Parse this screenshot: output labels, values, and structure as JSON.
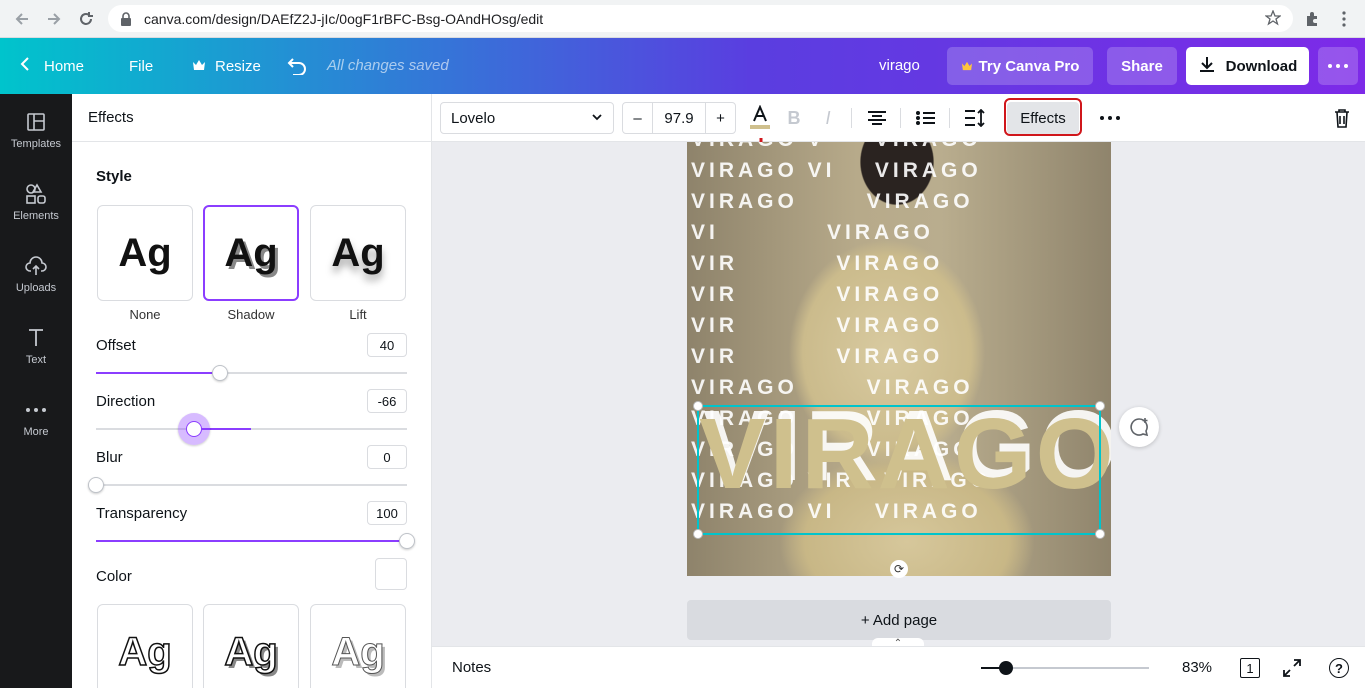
{
  "browser": {
    "url": "canva.com/design/DAEfZ2J-jIc/0ogF1rBFC-Bsg-OAndHOsg/edit"
  },
  "header": {
    "home_label": "Home",
    "file_label": "File",
    "resize_label": "Resize",
    "saved_status": "All changes saved",
    "design_title": "virago",
    "pro_label": "Try Canva Pro",
    "share_label": "Share",
    "download_label": "Download"
  },
  "rail": {
    "items": [
      {
        "label": "Templates",
        "icon": "templates-icon"
      },
      {
        "label": "Elements",
        "icon": "elements-icon"
      },
      {
        "label": "Uploads",
        "icon": "uploads-icon"
      },
      {
        "label": "Text",
        "icon": "text-icon"
      },
      {
        "label": "More",
        "icon": "more-icon"
      }
    ]
  },
  "panel": {
    "title": "Effects",
    "style_heading": "Style",
    "styles": [
      {
        "label": "None",
        "sample": "Ag"
      },
      {
        "label": "Shadow",
        "sample": "Ag",
        "selected": true
      },
      {
        "label": "Lift",
        "sample": "Ag"
      }
    ],
    "offset": {
      "label": "Offset",
      "value": "40",
      "fraction": 0.4
    },
    "direction": {
      "label": "Direction",
      "value": "-66",
      "fraction": 0.32
    },
    "blur": {
      "label": "Blur",
      "value": "0",
      "fraction": 0.0
    },
    "transparency": {
      "label": "Transparency",
      "value": "100",
      "fraction": 1.0
    },
    "color_label": "Color",
    "more_samples": [
      "Ag",
      "Ag",
      "Ag"
    ]
  },
  "toolbar": {
    "font": "Lovelo",
    "size": "97.9",
    "minus": "–",
    "plus": "+",
    "effects_label": "Effects"
  },
  "canvas": {
    "pattern_rows": [
      "VIRAGO V     VIRAGO",
      "VIRAGO VI    VIRAGO",
      "VIRAGO       VIRAGO",
      "VI           VIRAGO",
      "VIR          VIRAGO",
      "VIR          VIRAGO",
      "VIR          VIRAGO",
      "VIR          VIRAGO",
      "VIRAGO       VIRAGO",
      "VIRAGO       VIRAGO",
      "VIRAGO       VIRAGO",
      "VIRAGO VIR   VIRAGO",
      "VIRAGO VI    VIRAGO"
    ],
    "headline": "VIRAGO",
    "add_page_label": "+ Add page"
  },
  "footer": {
    "notes_label": "Notes",
    "zoom": "83%",
    "page_count": "1",
    "help": "?"
  },
  "colors": {
    "accent": "#8b3dff",
    "selection": "#00c4cc",
    "headline": "#cfc08d"
  }
}
